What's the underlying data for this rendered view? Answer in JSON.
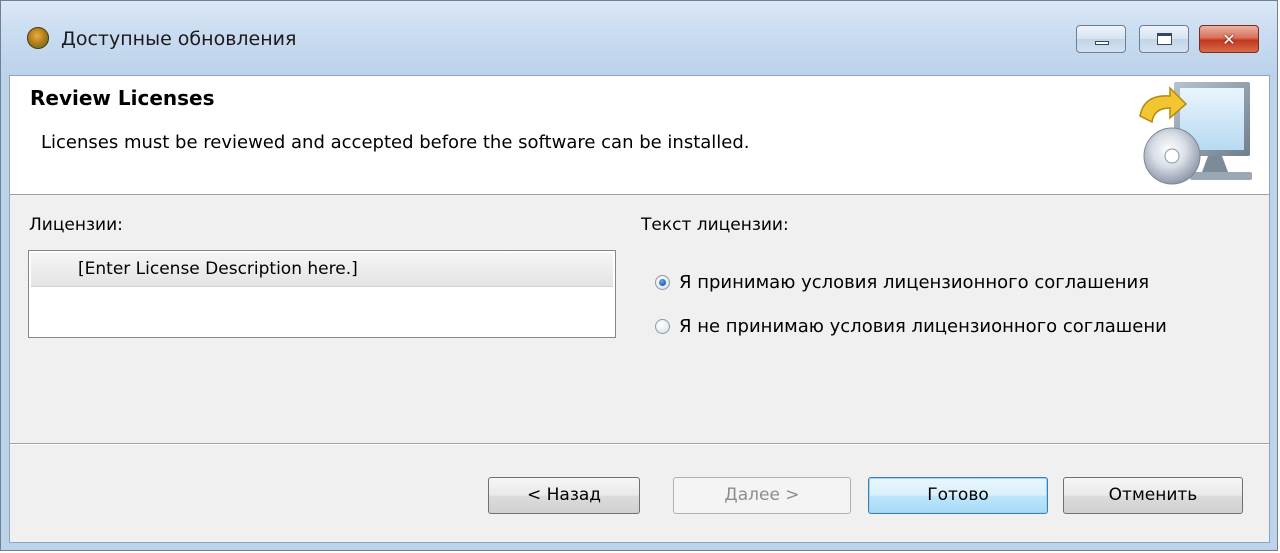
{
  "window": {
    "title": "Доступные обновления"
  },
  "header": {
    "title": "Review Licenses",
    "description": "Licenses must be reviewed and accepted before the software can be installed."
  },
  "licenses": {
    "label": "Лицензии:",
    "items": [
      "[Enter License Description here.]"
    ]
  },
  "license_text": {
    "label": "Текст лицензии:"
  },
  "agreement": {
    "accept_label": "Я принимаю условия лицензионного соглашения",
    "decline_label": "Я не принимаю условия лицензионного соглашени",
    "selected": "accept"
  },
  "buttons": {
    "back": "< Назад",
    "next": "Далее >",
    "finish": "Готово",
    "cancel": "Отменить"
  },
  "colors": {
    "titlebar": "#bcd2ea",
    "close_button": "#c2381e",
    "dialog_background": "#f0f0f0",
    "radio_selected": "#1f5fb8"
  }
}
